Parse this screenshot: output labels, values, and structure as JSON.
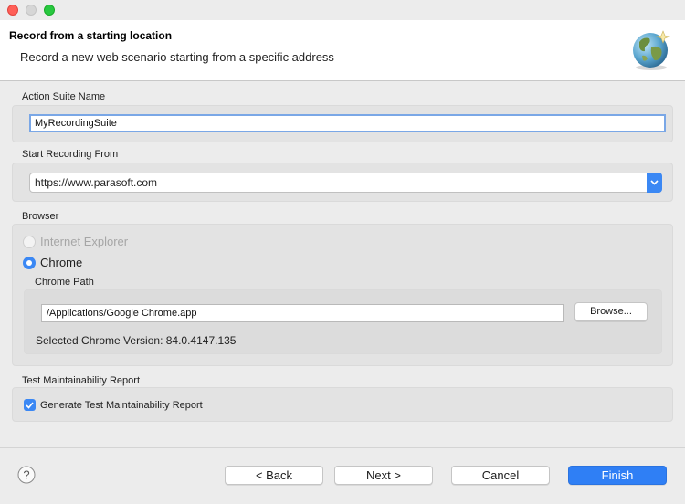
{
  "header": {
    "title": "Record from a starting location",
    "description": "Record a new web scenario starting from a specific address",
    "icon": "globe-icon"
  },
  "action_suite": {
    "label": "Action Suite Name",
    "value": "MyRecordingSuite"
  },
  "start_recording": {
    "label": "Start Recording From",
    "selected": "https://www.parasoft.com"
  },
  "browser": {
    "label": "Browser",
    "options": [
      {
        "label": "Internet Explorer",
        "selected": false,
        "enabled": false
      },
      {
        "label": "Chrome",
        "selected": true,
        "enabled": true
      }
    ],
    "chrome_path_label": "Chrome Path",
    "chrome_path_value": "/Applications/Google Chrome.app",
    "browse_label": "Browse...",
    "version_text": "Selected Chrome Version: 84.0.4147.135"
  },
  "maintainability": {
    "label": "Test Maintainability Report",
    "checkbox_label": "Generate Test Maintainability Report",
    "checked": true
  },
  "footer": {
    "help_icon": "help-icon",
    "back_label": "< Back",
    "next_label": "Next >",
    "cancel_label": "Cancel",
    "finish_label": "Finish"
  },
  "colors": {
    "accent": "#3b88f4",
    "primary_button": "#2f7ff5",
    "close": "#ff5f57",
    "maximize": "#28c840"
  }
}
